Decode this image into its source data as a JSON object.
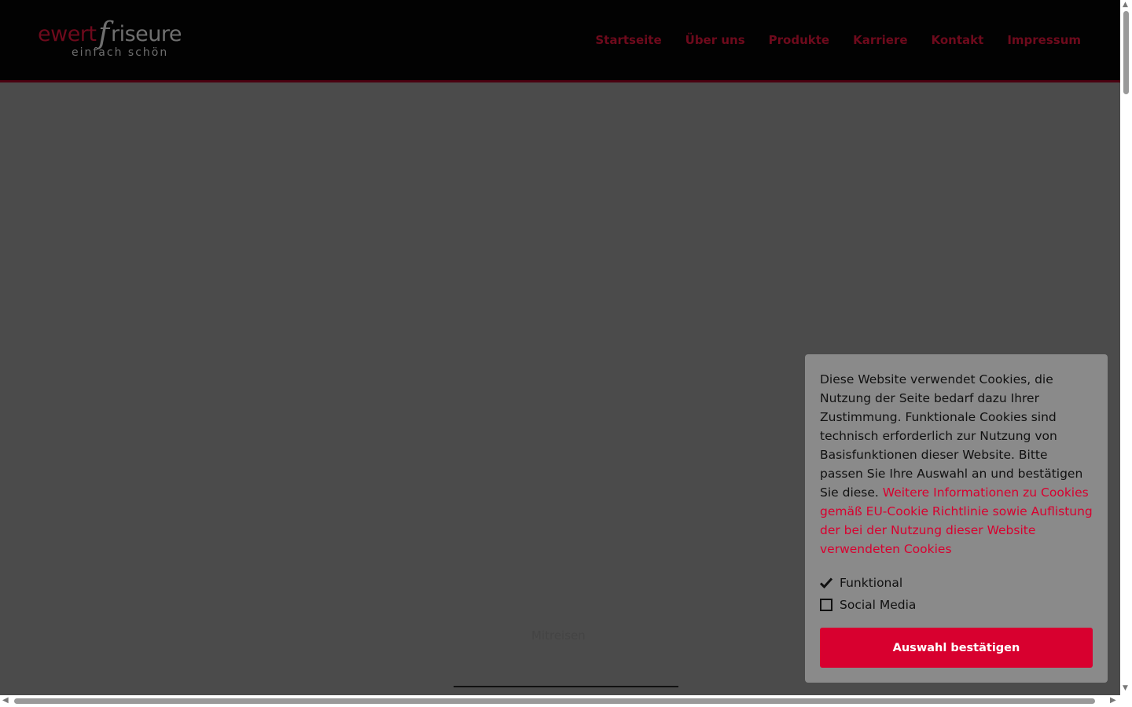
{
  "logo": {
    "word1": "ewert",
    "f": "f",
    "word2": "riseure",
    "tagline": "einfach schön"
  },
  "nav": [
    "Startseite",
    "Über uns",
    "Produkte",
    "Karriere",
    "Kontakt",
    "Impressum"
  ],
  "hero": {
    "label": "Mitreisen"
  },
  "cookie": {
    "text": "Diese Website verwendet Cookies, die Nutzung der Seite bedarf dazu Ihrer Zustimmung. Funktionale Cookies sind technisch erforderlich zur Nutzung von Basisfunktionen dieser Website. Bitte passen Sie Ihre Auswahl an und bestätigen Sie diese.",
    "link": "Weitere Informationen zu Cookies gemäß EU-Cookie Richtlinie sowie Auflistung der bei der Nutzung dieser Website verwendeten Cookies",
    "options": [
      {
        "label": "Funktional",
        "checked": true
      },
      {
        "label": "Social Media",
        "checked": false
      }
    ],
    "confirm": "Auswahl bestätigen"
  },
  "colors": {
    "accent": "#d8002f",
    "nav_text": "#6e0a1c",
    "overlay": "#4b4b4b",
    "header_bg": "#020202",
    "cookie_bg": "#8a8a8a"
  }
}
